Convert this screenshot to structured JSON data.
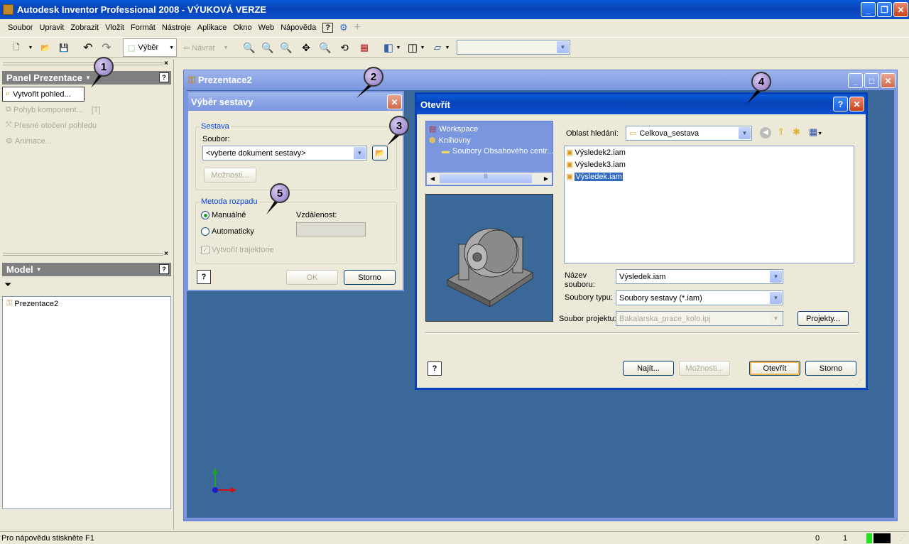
{
  "app": {
    "title": "Autodesk Inventor Professional 2008 - VÝUKOVÁ VERZE"
  },
  "menu": [
    "Soubor",
    "Upravit",
    "Zobrazit",
    "Vložit",
    "Formát",
    "Nástroje",
    "Aplikace",
    "Okno",
    "Web",
    "Nápověda"
  ],
  "toolbar": {
    "select_label": "Výběr",
    "back_label": "Návrat"
  },
  "panel": {
    "title": "Panel Prezentace",
    "items": [
      "Vytvořit pohled...",
      "Pohyb komponent...",
      "Přesné otočení pohledu",
      "Animace..."
    ],
    "shortcut": "[T]"
  },
  "model": {
    "title": "Model",
    "tree_item": "Prezentace2"
  },
  "doc_window": {
    "title": "Prezentace2"
  },
  "select_dialog": {
    "title": "Výběr sestavy",
    "group_assembly": "Sestava",
    "file_label": "Soubor:",
    "file_value": "<vyberte dokument sestavy>",
    "options_button": "Možnosti...",
    "group_method": "Metoda rozpadu",
    "radio_manual": "Manuálně",
    "radio_auto": "Automaticky",
    "distance_label": "Vzdálenost:",
    "check_traj": "Vytvořit trajektorie",
    "ok": "OK",
    "cancel": "Storno"
  },
  "open_dialog": {
    "title": "Otevřít",
    "tree": [
      "Workspace",
      "Knihovny",
      "Soubory Obsahového centr..."
    ],
    "scroll_grip": "|||",
    "look_in_label": "Oblast hledání:",
    "look_in_value": "Celkova_sestava",
    "files": [
      "Výsledek2.iam",
      "Výsledek3.iam",
      "Výsledek.iam"
    ],
    "filename_label": "Název souboru:",
    "filename_value": "Výsledek.iam",
    "filetype_label": "Soubory typu:",
    "filetype_value": "Soubory sestavy (*.iam)",
    "project_label": "Soubor projektu:",
    "project_value": "Bakalarska_prace_kolo.ipj",
    "projects_button": "Projekty...",
    "find_button": "Najít...",
    "options_button": "Možnosti...",
    "open_button": "Otevřít",
    "cancel_button": "Storno"
  },
  "callouts": [
    "1",
    "2",
    "3",
    "4",
    "5"
  ],
  "status": {
    "text": "Pro nápovědu stiskněte F1",
    "n1": "0",
    "n2": "1"
  },
  "colors": {
    "accent": "#0a5bd8",
    "viewport": "#3a6898",
    "select": "#316ac5"
  }
}
